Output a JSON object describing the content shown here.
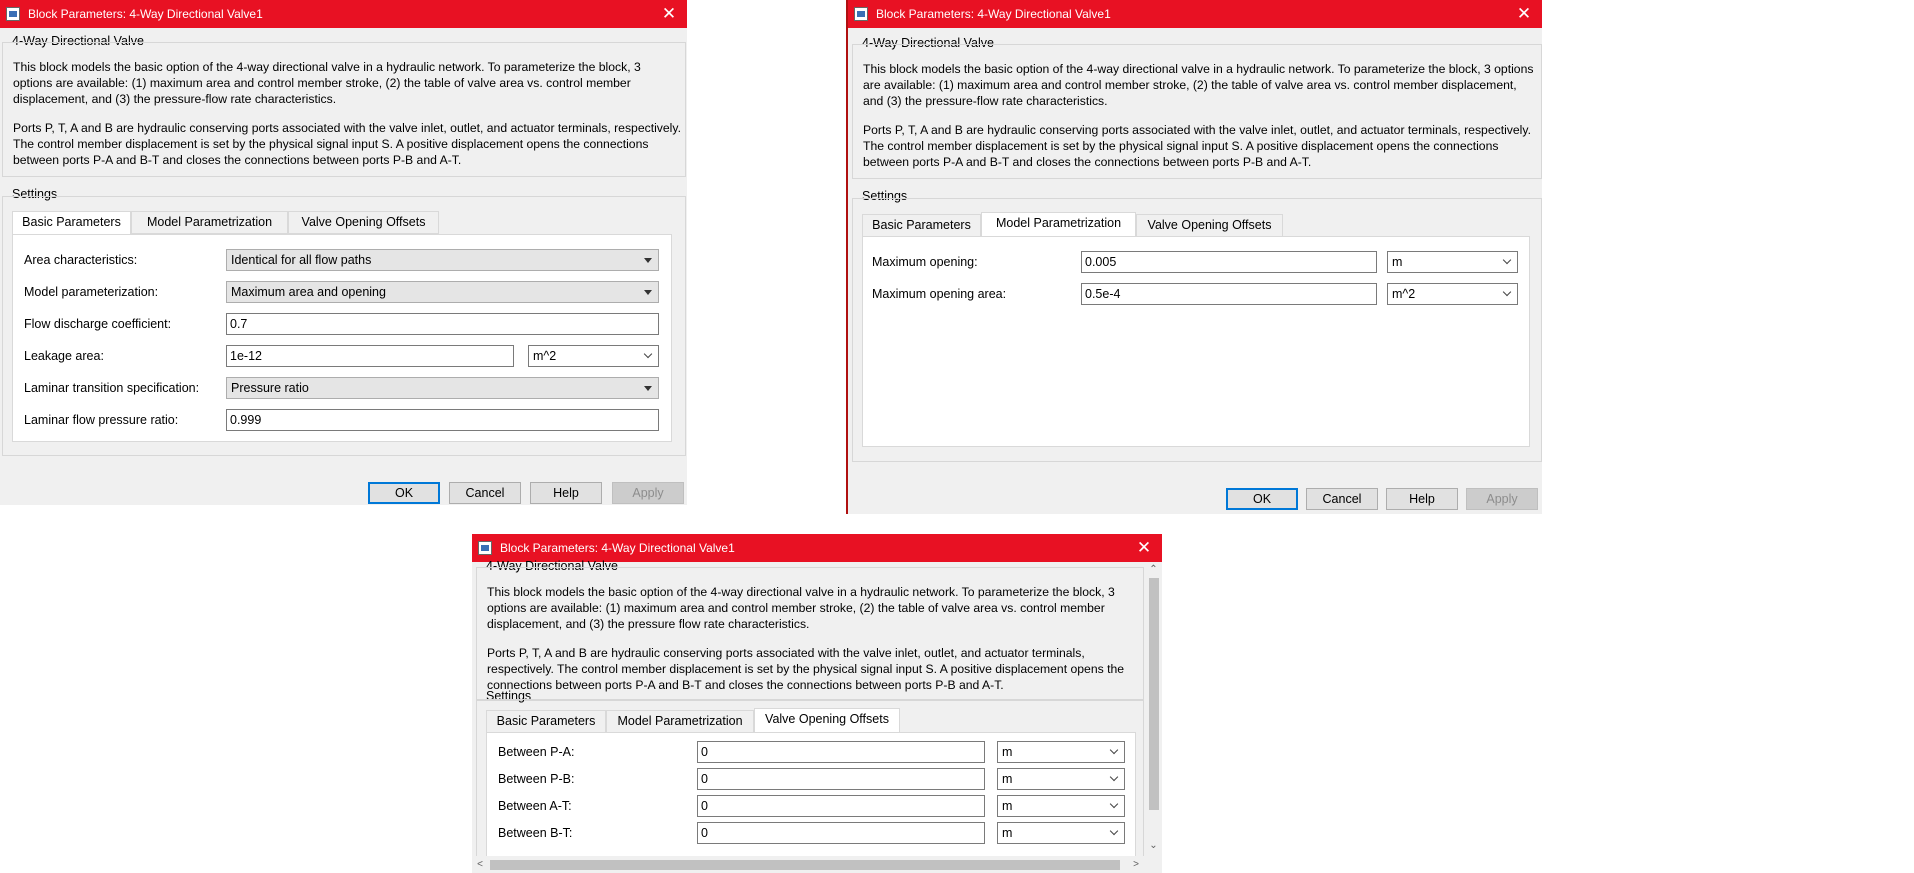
{
  "dialog1": {
    "title": "Block Parameters: 4-Way Directional Valve1",
    "block_name": "4-Way Directional Valve",
    "description": [
      "This block models the basic option of the 4-way directional valve in a hydraulic network. To parameterize the block, 3 options are available: (1) maximum area and control member stroke, (2) the table of valve area vs. control member displacement, and (3) the pressure-flow rate characteristics.",
      "Ports P, T, A and B are hydraulic conserving ports associated with the valve inlet, outlet, and actuator terminals, respectively. The control member displacement is set by the physical signal input S. A positive displacement opens the connections between ports P-A and B-T and closes the connections between ports P-B and A-T."
    ],
    "settings_label": "Settings",
    "tabs": [
      "Basic Parameters",
      "Model Parametrization",
      "Valve Opening Offsets"
    ],
    "active_tab": "Basic Parameters",
    "params": [
      {
        "label": "Area characteristics:",
        "value": "Identical for all flow paths"
      },
      {
        "label": "Model parameterization:",
        "value": "Maximum area and opening"
      },
      {
        "label": "Flow discharge coefficient:",
        "value": "0.7"
      },
      {
        "label": "Leakage area:",
        "value": "1e-12",
        "unit": "m^2"
      },
      {
        "label": "Laminar transition specification:",
        "value": "Pressure ratio"
      },
      {
        "label": "Laminar flow pressure ratio:",
        "value": "0.999"
      }
    ],
    "buttons": [
      "OK",
      "Cancel",
      "Help",
      "Apply"
    ]
  },
  "dialog2": {
    "title": "Block Parameters: 4-Way Directional Valve1",
    "block_name": "4-Way Directional Valve",
    "description": [
      "This block models the basic option of the 4-way directional valve in a hydraulic network. To parameterize the block, 3 options are available: (1) maximum area and control member stroke, (2) the table of valve area vs. control member displacement, and (3) the pressure-flow rate characteristics.",
      "Ports P, T, A and B are hydraulic conserving ports associated with the valve inlet, outlet, and actuator terminals, respectively. The control member displacement is set by the physical signal input S. A positive displacement opens the connections between ports P-A and B-T and closes the connections between ports P-B and A-T."
    ],
    "settings_label": "Settings",
    "tabs": [
      "Basic Parameters",
      "Model Parametrization",
      "Valve Opening Offsets"
    ],
    "active_tab": "Model Parametrization",
    "params": [
      {
        "label": "Maximum opening:",
        "value": "0.005",
        "unit": "m"
      },
      {
        "label": "Maximum opening area:",
        "value": "0.5e-4",
        "unit": "m^2"
      }
    ],
    "buttons": [
      "OK",
      "Cancel",
      "Help",
      "Apply"
    ]
  },
  "dialog3": {
    "title": "Block Parameters: 4-Way Directional Valve1",
    "block_name": "4-Way Directional Valve",
    "description": [
      "This block models the basic option of the 4-way directional valve in a hydraulic network. To parameterize the block, 3 options are available: (1) maximum area and control member stroke, (2) the table of valve area vs. control member displacement, and (3) the pressure flow rate characteristics.",
      "Ports P, T, A and B are hydraulic conserving ports associated with the valve inlet, outlet, and actuator terminals, respectively. The control member displacement is set by the physical signal input S. A positive displacement opens the connections between ports P-A and B-T and closes the connections between ports P-B and A-T."
    ],
    "settings_label": "Settings",
    "tabs": [
      "Basic Parameters",
      "Model Parametrization",
      "Valve Opening Offsets"
    ],
    "active_tab": "Valve Opening Offsets",
    "params": [
      {
        "label": "Between P-A:",
        "value": "0",
        "unit": "m"
      },
      {
        "label": "Between P-B:",
        "value": "0",
        "unit": "m"
      },
      {
        "label": "Between A-T:",
        "value": "0",
        "unit": "m"
      },
      {
        "label": "Between B-T:",
        "value": "0",
        "unit": "m"
      }
    ]
  },
  "colors": {
    "titlebar": "#e81123",
    "dialog_bg": "#f0f0f0",
    "focus": "#0078d7"
  },
  "icons": [
    "simulink-block-icon",
    "close-icon",
    "dropdown-caret-icon",
    "chevron-down-icon",
    "scroll-up-icon",
    "scroll-down-icon",
    "scroll-left-icon",
    "scroll-right-icon"
  ]
}
